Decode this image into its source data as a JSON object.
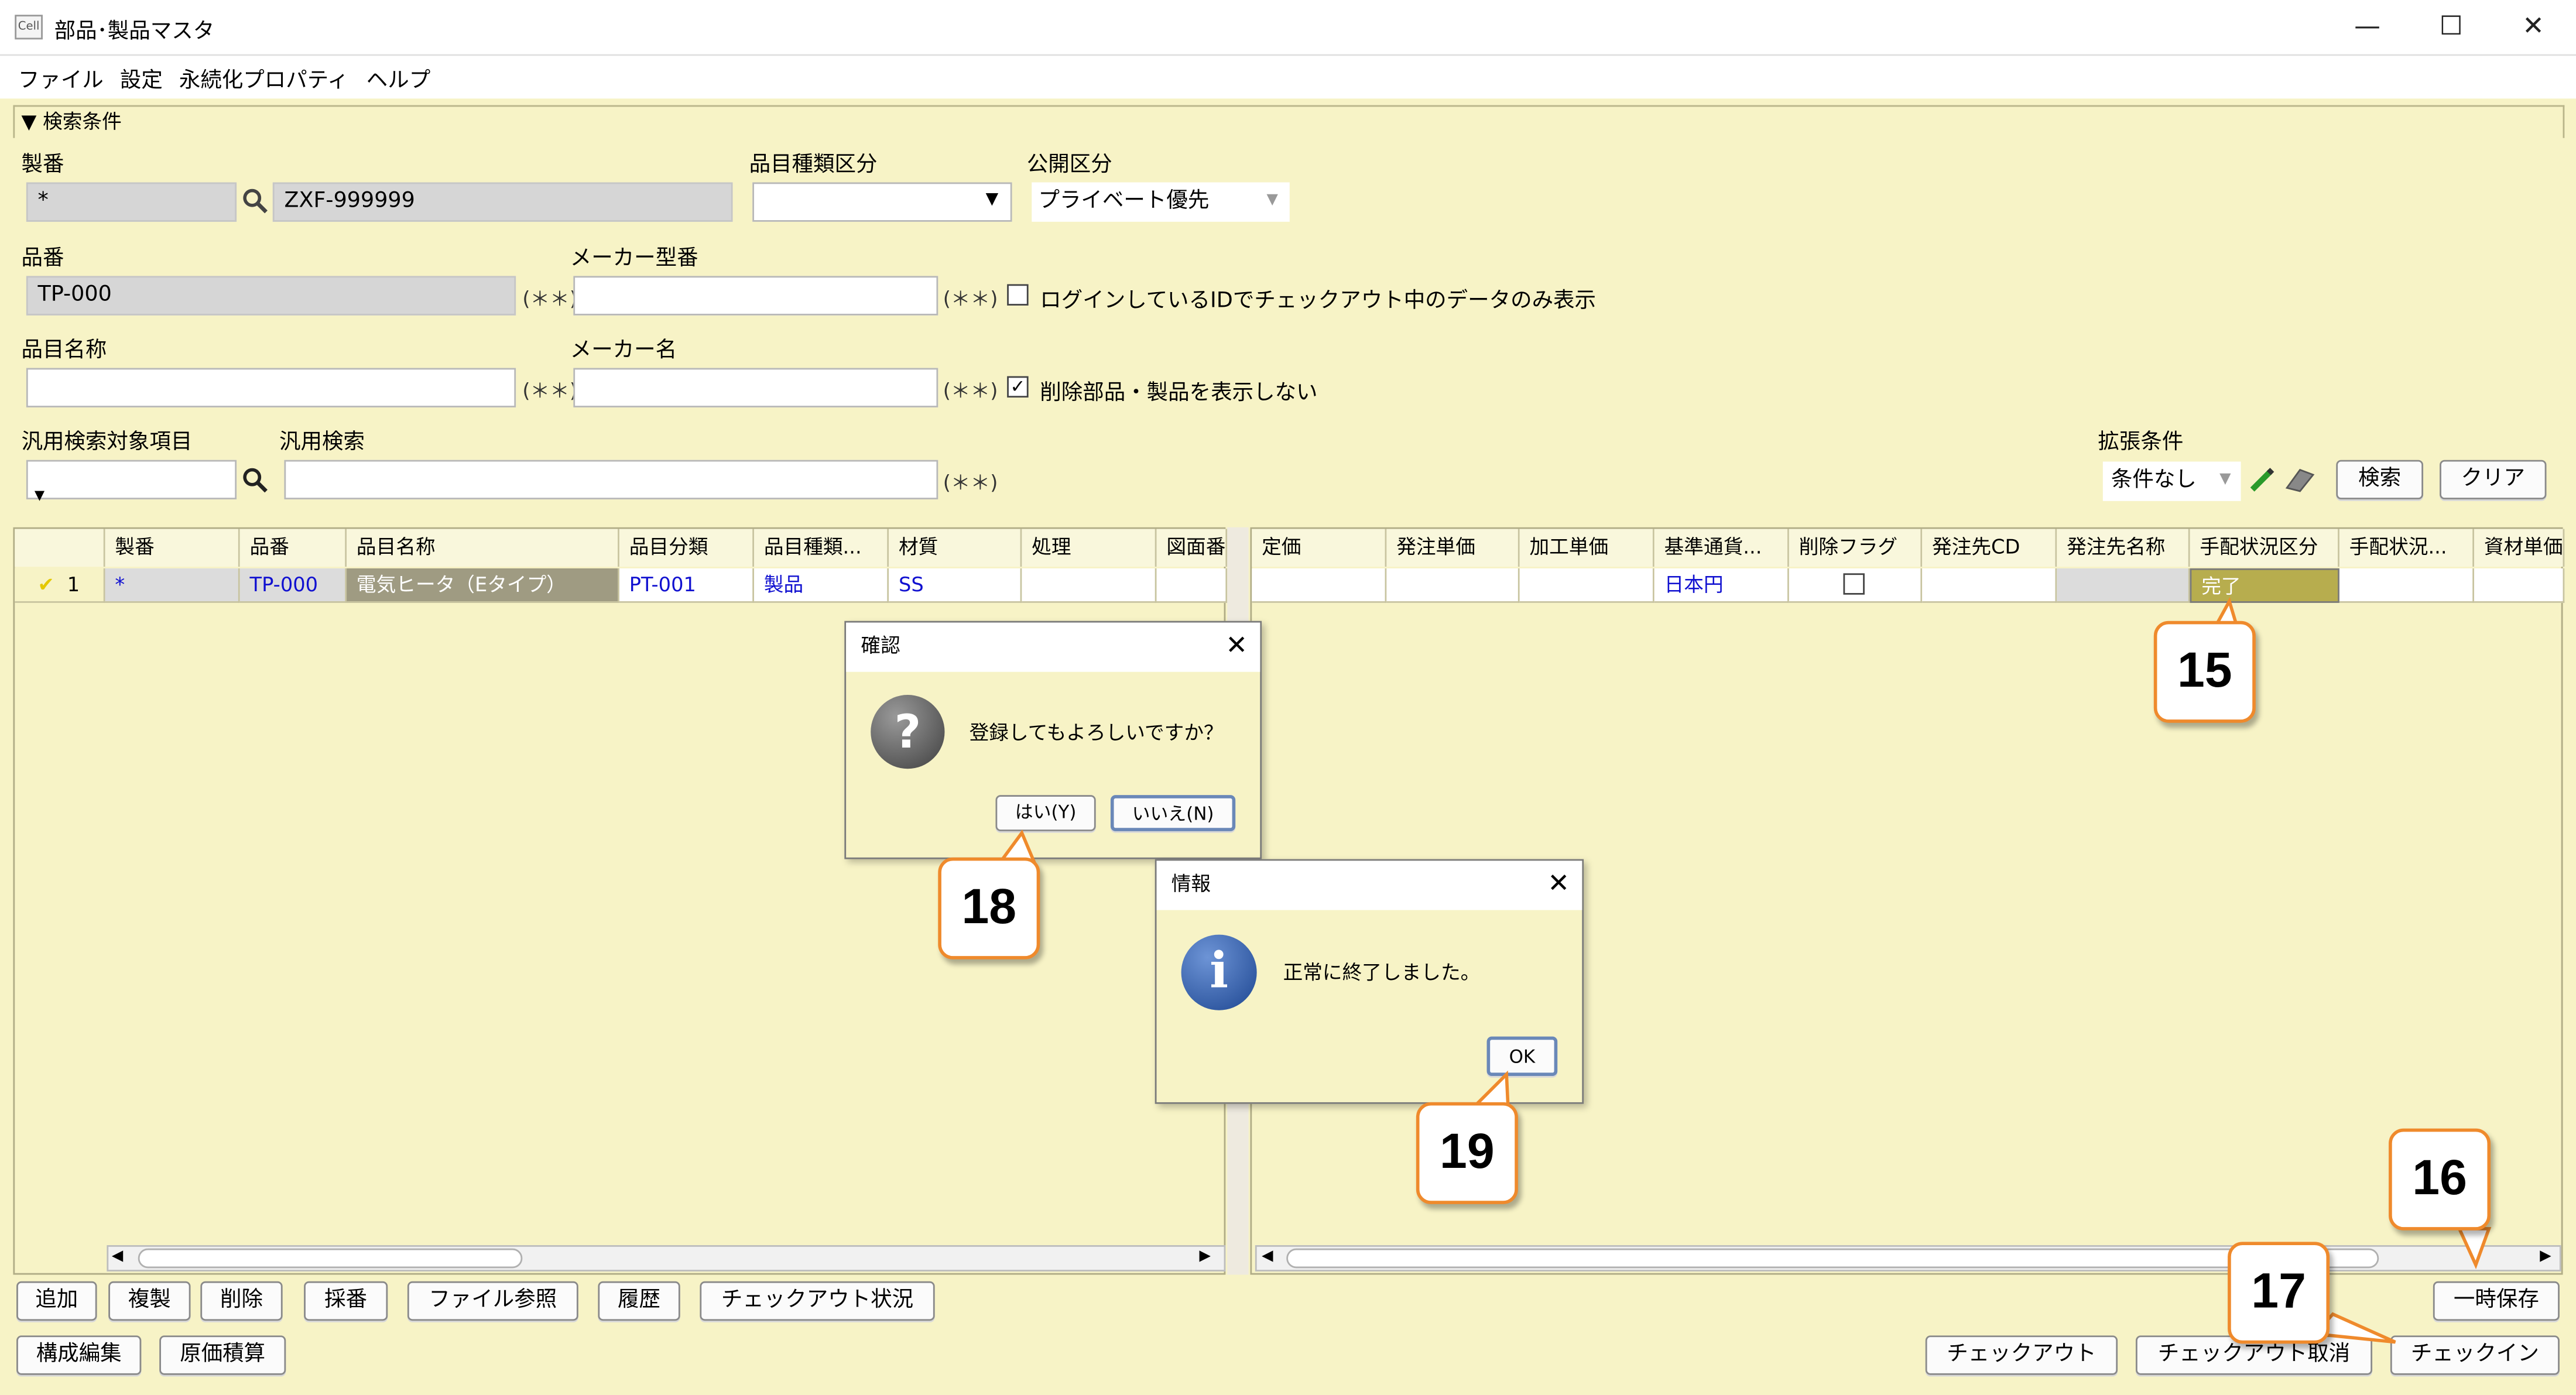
{
  "window": {
    "title": "部品･製品マスタ",
    "app_icon": "Cell",
    "minimize": "—",
    "maximize": "☐",
    "close": "✕"
  },
  "menu": [
    "ファイル",
    "設定",
    "永続化プロパティ",
    "ヘルプ"
  ],
  "search": {
    "section_title": "▼ 検索条件",
    "seiban_label": "製番",
    "seiban_value": "*",
    "seiban_lookup": "ZXF-999999",
    "item_type_label": "品目種類区分",
    "item_type_value": "",
    "public_label": "公開区分",
    "public_value": "プライベート優先",
    "hinban_label": "品番",
    "hinban_value": "TP-000",
    "maker_model_label": "メーカー型番",
    "maker_model_value": "",
    "checkout_only_label": "ログインしているIDでチェックアウト中のデータのみ表示",
    "checkout_only_checked": false,
    "item_name_label": "品目名称",
    "item_name_value": "",
    "maker_name_label": "メーカー名",
    "maker_name_value": "",
    "hide_deleted_label": "削除部品・製品を表示しない",
    "hide_deleted_checked": true,
    "general_target_label": "汎用検索対象項目",
    "general_target_value": "",
    "general_search_label": "汎用検索",
    "general_search_value": "",
    "wildcard_hint": "(＊＊)",
    "ext_label": "拡張条件",
    "ext_value": "条件なし",
    "search_button": "検索",
    "clear_button": "クリア"
  },
  "left_grid": {
    "columns": [
      "製番",
      "品番",
      "品目名称",
      "品目分類",
      "品目種類...",
      "材質",
      "処理",
      "図面番"
    ],
    "row": {
      "mark": "✔",
      "index": "1",
      "seiban": "*",
      "hinban": "TP-000",
      "item_name": "電気ヒータ（Eタイプ）",
      "category": "PT-001",
      "kind": "製品",
      "material": "SS",
      "process": "",
      "drawing": ""
    }
  },
  "right_grid": {
    "columns": [
      "定価",
      "発注単価",
      "加工単価",
      "基準通貨...",
      "削除フラグ",
      "発注先CD",
      "発注先名称",
      "手配状況区分",
      "手配状況...",
      "資材単価"
    ],
    "row": {
      "list_price": "",
      "order_price": "",
      "process_price": "",
      "currency": "日本円",
      "delete_flag": false,
      "supplier_cd": "",
      "supplier_name": "",
      "arrangement_status": "完了",
      "arrangement_status2": "",
      "material_price": ""
    }
  },
  "bottom_buttons": {
    "add": "追加",
    "copy": "複製",
    "delete": "削除",
    "number": "採番",
    "file_ref": "ファイル参照",
    "history": "履歴",
    "checkout_status": "チェックアウト状況",
    "structure_edit": "構成編集",
    "cost_estimate": "原価積算",
    "temp_save": "一時保存",
    "checkout": "チェックアウト",
    "cancel_checkout": "チェックアウト取消",
    "checkin": "チェックイン"
  },
  "confirm_dialog": {
    "title": "確認",
    "close": "✕",
    "icon": "?",
    "message": "登録してもよろしいですか？",
    "yes": "はい(Y)",
    "no": "いいえ(N)"
  },
  "info_dialog": {
    "title": "情報",
    "close": "✕",
    "icon": "i",
    "message": "正常に終了しました。",
    "ok": "OK"
  },
  "callouts": [
    "15",
    "16",
    "17",
    "18",
    "19"
  ],
  "colors": {
    "panel": "#f7f3c6",
    "callout_border": "#ef8a2c",
    "status_cell": "#b7ad4e",
    "link_blue": "#1010d0"
  }
}
